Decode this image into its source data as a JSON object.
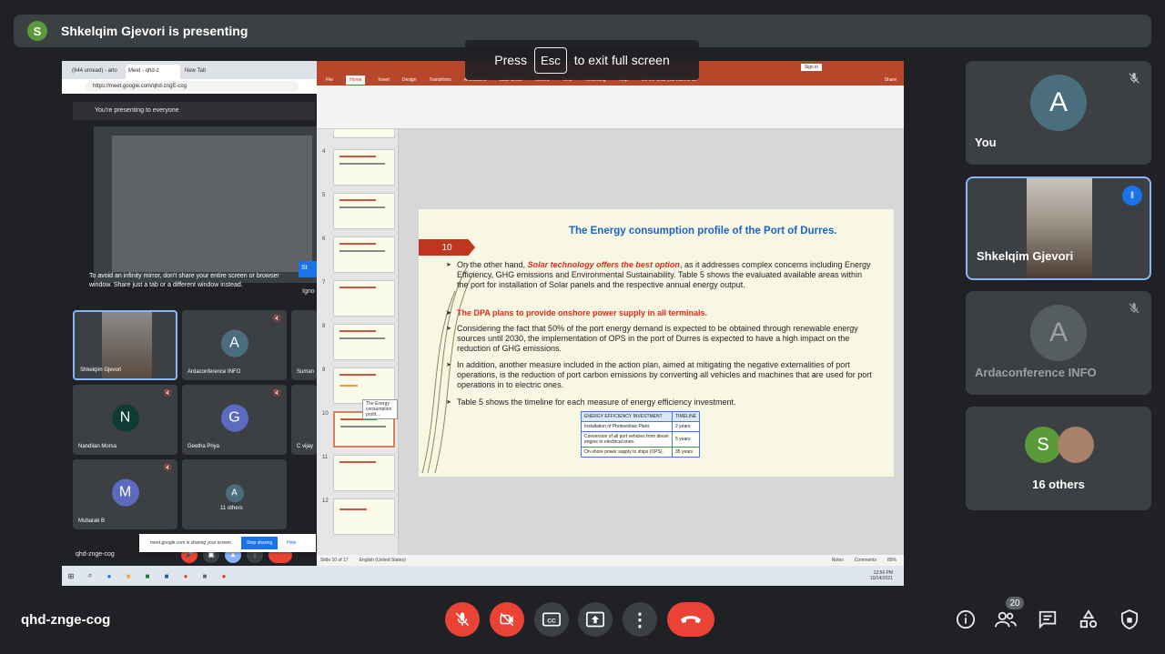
{
  "banner": {
    "avatar_letter": "S",
    "text": "Shkelqim Gjevori is presenting"
  },
  "esc_toast": {
    "press": "Press",
    "key": "Esc",
    "rest": "to exit full screen"
  },
  "shared_screen": {
    "browser": {
      "tabs": [
        "(844 unread) - arlo",
        "Meet - qhd-z",
        "New Tab"
      ],
      "url": "https://meet.google.com/qhd-zngE-cog"
    },
    "present_bar": "You're presenting to everyone",
    "mirror_note": "To avoid an infinity mirror, don't share your entire screen or browser window. Share just a tab or a different window instead.",
    "mirror_ignore": "Igno",
    "mirror_stop": "St",
    "mini_tiles": [
      {
        "name": "Shkelqim Gjevori",
        "letter": "",
        "color": "#000000"
      },
      {
        "name": "Ardaconference INFO",
        "letter": "A",
        "color": "#4a6e7d"
      },
      {
        "name": "Suman",
        "letter": "",
        "color": "#3c4043"
      },
      {
        "name": "Nandilan Morsa",
        "letter": "N",
        "color": "#0e3b33"
      },
      {
        "name": "Geetha Priya",
        "letter": "G",
        "color": "#5c6bc0"
      },
      {
        "name": "C vijay",
        "letter": "",
        "color": "#3c4043"
      },
      {
        "name": "Mubarak B",
        "letter": "M",
        "color": "#5c6bc0"
      },
      {
        "name": "11 others",
        "letter": "A",
        "color": "#4a6e7d"
      }
    ],
    "mini_code": "qhd-znge-cog",
    "ppt": {
      "menus": [
        "File",
        "Home",
        "Insert",
        "Design",
        "Transitions",
        "Animations",
        "Slide Show",
        "Review",
        "View",
        "Recording",
        "Help",
        "Tell me what you want to do"
      ],
      "signin": "Sign in",
      "share": "Share",
      "thumbnails": [
        "4",
        "5",
        "6",
        "7",
        "8",
        "9",
        "10",
        "11",
        "12"
      ],
      "tooltip": "The Energy consumption profil...",
      "status": [
        "Slide 10 of 17",
        "English (United States)",
        "Notes",
        "Comments",
        "85%"
      ],
      "slide": {
        "number": "10",
        "title": "The Energy consumption profile of the Port of Durres.",
        "b1_pre": "On the other hand,",
        "b1_hl": "Solar technology offers the best option",
        "b1_post": ", as it addresses complex concerns including Energy Efficiency, GHG emissions and Environmental Sustainability. Table 5 shows the evaluated available areas within the port for installation of Solar panels and the respective annual energy output.",
        "b2": "The DPA plans to provide onshore power supply in all terminals.",
        "b3": "Considering the fact that 50% of the port energy demand is expected to be obtained through renewable energy sources until 2030, the implementation of OPS in the port of Durres is expected to have a high impact on the reduction of GHG emissions.",
        "b4": "In addition, another measure included in the action plan, aimed at mitigating the negative externalities of port operations, is the reduction of port carbon emissions by converting all vehicles and machines that are used for port operations in to electric ones.",
        "b5": "Table 5 shows the timeline for each measure of energy efficiency investment.",
        "table_headers": [
          "ENERGY EFFICIENCY INVESTMENT",
          "TIMELINE"
        ],
        "table_rows": [
          [
            "Installation of Photovoltaic Plant.",
            "2 years"
          ],
          [
            "Conversion of all port vehicles from diesel engine to electrical ones.",
            "5 years"
          ],
          [
            "On-shore power supply to ships (OPS).",
            "35 years"
          ]
        ]
      }
    },
    "sharebar": {
      "text": "meet.google.com is sharing your screen.",
      "stop": "Stop sharing",
      "hide": "Hide"
    },
    "taskbar_clock": [
      "12:56 PM",
      "10/14/2021"
    ]
  },
  "tiles": [
    {
      "name": "You",
      "letter": "A",
      "mic": "muted"
    },
    {
      "name": "Shkelqim Gjevori",
      "speaking": true
    },
    {
      "name": "Ardaconference INFO",
      "letter": "A",
      "mic": "muted"
    },
    {
      "name": "16 others",
      "letter": "S"
    }
  ],
  "bottom": {
    "meeting_code": "qhd-znge-cog",
    "participants_count": "20"
  },
  "colors": {
    "danger": "#ea4335",
    "accent": "#8ab4f8",
    "surface": "#3c4043",
    "background": "#202124"
  }
}
